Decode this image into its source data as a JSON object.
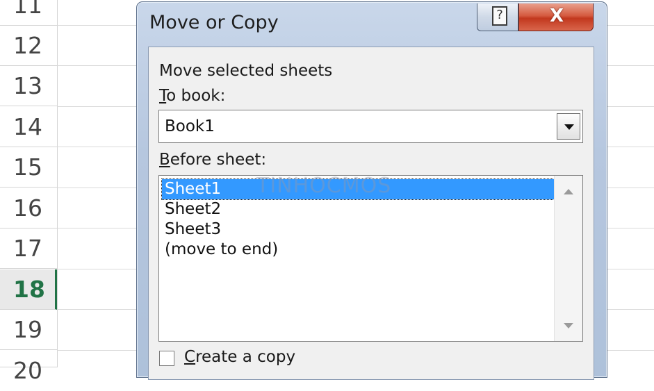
{
  "spreadsheet": {
    "rows": [
      "11",
      "12",
      "13",
      "14",
      "15",
      "16",
      "17",
      "18",
      "19",
      "20"
    ],
    "active_row": "18",
    "active_color": "#217346"
  },
  "dialog": {
    "title": "Move or Copy",
    "help_symbol": "?",
    "close_symbol": "X",
    "move_label": "Move selected sheets",
    "to_book_label": "To book:",
    "to_book_value": "Book1",
    "before_sheet_label": "Before sheet:",
    "sheets": [
      "Sheet1",
      "Sheet2",
      "Sheet3",
      "(move to end)"
    ],
    "selected_sheet": "Sheet1",
    "selection_color": "#3399ff",
    "create_copy_label": "Create a copy",
    "create_copy_checked": false
  },
  "watermark": "TINHOCMOS"
}
